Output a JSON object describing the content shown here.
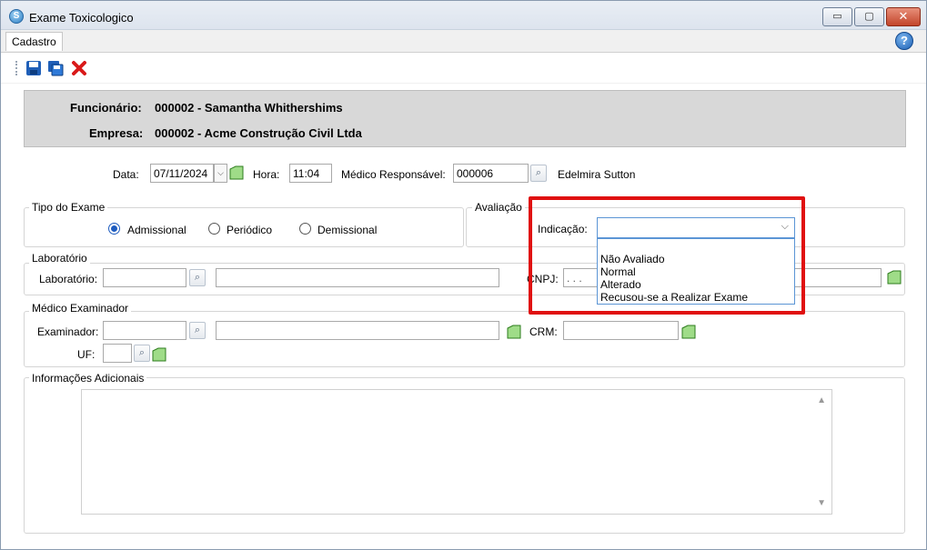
{
  "window": {
    "title": "Exame Toxicologico",
    "min_label": "▭",
    "max_label": "▢",
    "close_label": "✕"
  },
  "tabs": [
    "Cadastro"
  ],
  "help_icon": "?",
  "header": {
    "funcionario_label": "Funcionário:",
    "funcionario_value": "000002 - Samantha Whithershims",
    "empresa_label": "Empresa:",
    "empresa_value": "000002 - Acme Construção Civil Ltda"
  },
  "top_fields": {
    "data_label": "Data:",
    "data_value": "07/11/2024",
    "hora_label": "Hora:",
    "hora_value": "11:04",
    "medico_label": "Médico Responsável:",
    "medico_value": "000006",
    "medico_name": "Edelmira Sutton"
  },
  "tipo_exame": {
    "title": "Tipo do Exame",
    "options": [
      {
        "label": "Admissional",
        "selected": true
      },
      {
        "label": "Periódico",
        "selected": false
      },
      {
        "label": "Demissional",
        "selected": false
      }
    ]
  },
  "avaliacao": {
    "title": "Avaliação",
    "indicacao_label": "Indicação:",
    "indicacao_value": "",
    "options": [
      "Não Avaliado",
      "Normal",
      "Alterado",
      "Recusou-se a Realizar Exame"
    ]
  },
  "laboratorio": {
    "title": "Laboratório",
    "label": "Laboratório:",
    "code": "",
    "name": "",
    "cnpj_label": "CNPJ:",
    "cnpj_value": ". . ."
  },
  "medico_examinador": {
    "title": "Médico Examinador",
    "examinador_label": "Examinador:",
    "crm_label": "CRM:",
    "uf_label": "UF:"
  },
  "info": {
    "title": "Informações Adicionais",
    "text": ""
  },
  "colors": {
    "highlight": "#e01010",
    "accent": "#1e5cbf"
  }
}
